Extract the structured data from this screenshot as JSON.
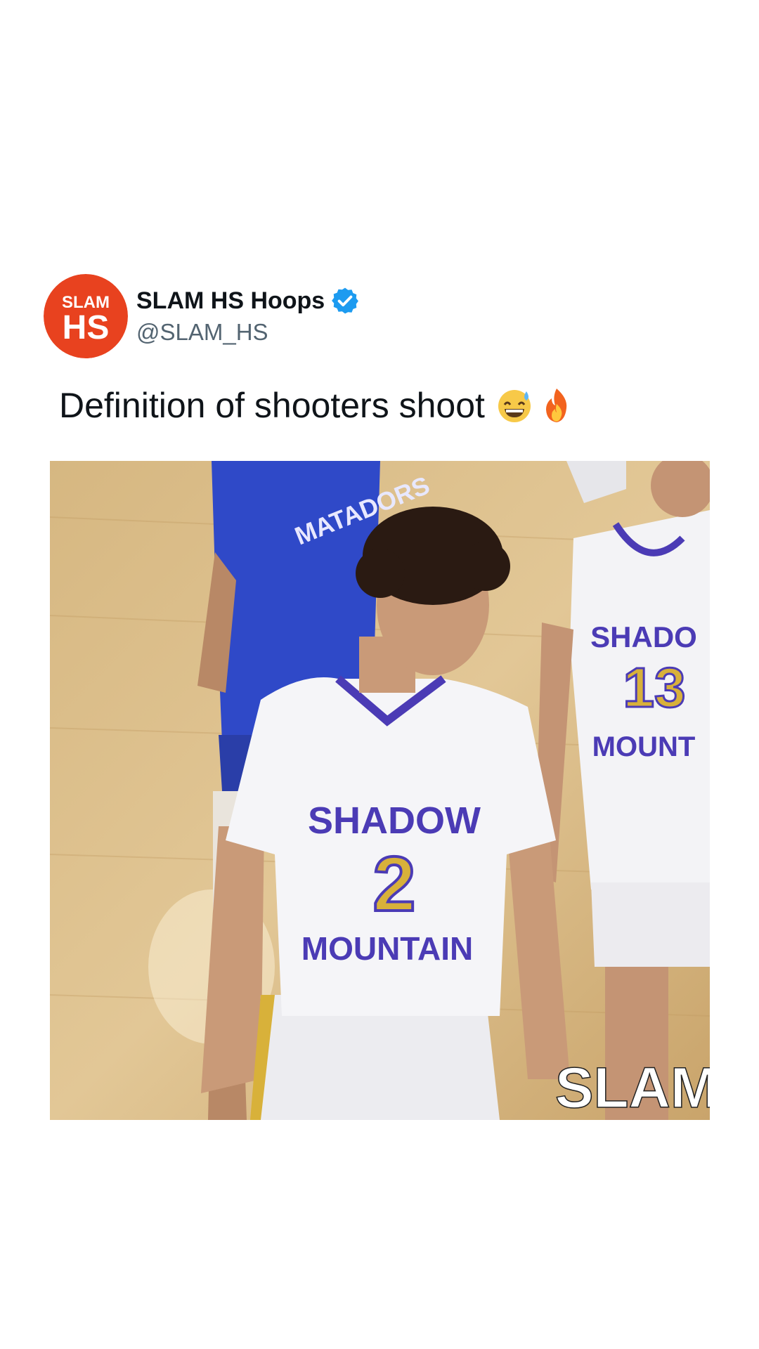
{
  "tweet": {
    "display_name": "SLAM HS Hoops",
    "handle": "@SLAM_HS",
    "verified": true,
    "verified_icon": "verified-badge-icon",
    "text": "Definition of shooters shoot",
    "emojis": [
      "grinning-sweat-emoji",
      "fire-emoji"
    ],
    "avatar": {
      "top_text": "SLAM",
      "bottom_text": "HS",
      "color": "#e8421f"
    }
  },
  "media": {
    "jersey_main": {
      "team_top": "SHADOW",
      "number": "2",
      "team_bottom": "MOUNTAIN"
    },
    "jersey_right": {
      "team_top": "SHADO",
      "number": "13",
      "team_bottom": "MOUNT"
    },
    "opponent_jersey_text": "MATADORS",
    "watermark": "SLAM"
  },
  "colors": {
    "text_primary": "#0f1419",
    "text_secondary": "#536471",
    "verified_blue": "#1d9bf0",
    "court": "#d9bc8a",
    "jersey_purple": "#4b3bb5",
    "jersey_gold": "#d8b13a",
    "opponent_blue": "#2f49c8"
  }
}
